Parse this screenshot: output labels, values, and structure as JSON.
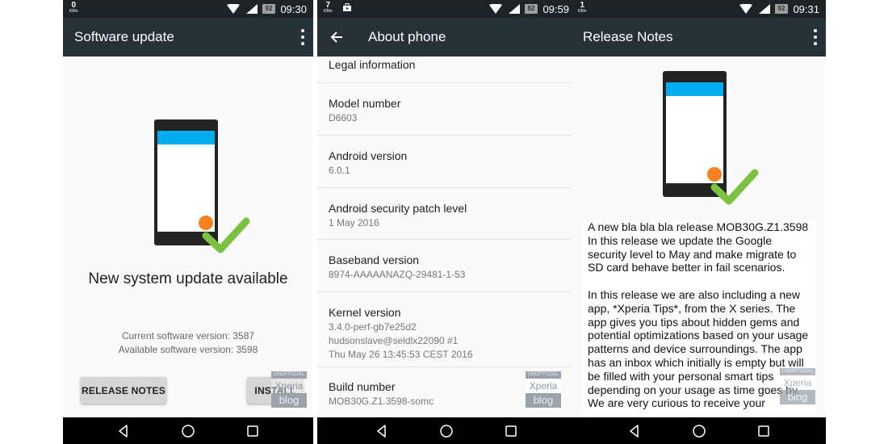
{
  "screens": [
    {
      "statusbar": {
        "speed": "0",
        "speed_unit": "KB/s",
        "battery": "92",
        "time": "09:30"
      },
      "appbar": {
        "title": "Software update",
        "menu_icon": "overflow-menu-icon"
      },
      "headline": "New system update available",
      "current_version_label": "Current software version:",
      "current_version": "3587",
      "available_version_label": "Available software version:",
      "available_version": "3598",
      "buttons": {
        "release_notes": "RELEASE NOTES",
        "install": "INSTALL"
      },
      "watermark": {
        "top": "UNOFFICIAL",
        "mid": "Xperia",
        "bot": "blog"
      }
    },
    {
      "statusbar": {
        "speed": "7",
        "speed_unit": "KB/s",
        "battery": "82",
        "time": "09:59",
        "extra_icon": "briefcase-icon"
      },
      "appbar": {
        "title": "About phone",
        "back_icon": "back-arrow-icon"
      },
      "items": [
        {
          "label": "Legal information",
          "lines": []
        },
        {
          "label": "Model number",
          "lines": [
            "D6603"
          ]
        },
        {
          "label": "Android version",
          "lines": [
            "6.0.1"
          ]
        },
        {
          "label": "Android security patch level",
          "lines": [
            "1 May 2016"
          ]
        },
        {
          "label": "Baseband version",
          "lines": [
            "8974-AAAAANAZQ-29481-1-53"
          ]
        },
        {
          "label": "Kernel version",
          "lines": [
            "3.4.0-perf-gb7e25d2",
            "hudsonslave@seldlx22090 #1",
            "Thu May 26 13:45:53 CEST 2016"
          ]
        },
        {
          "label": "Build number",
          "lines": [
            "MOB30G.Z1.3598-somc"
          ]
        }
      ],
      "watermark": {
        "top": "UNOFFICIAL",
        "mid": "Xperia",
        "bot": "blog"
      }
    },
    {
      "statusbar": {
        "speed": "1",
        "speed_unit": "KB/s",
        "battery": "92",
        "time": "09:31"
      },
      "appbar": {
        "title": "Release Notes",
        "menu_icon": "overflow-menu-icon"
      },
      "paragraphs": [
        "A new bla bla bla release MOB30G.Z1.3598 In this release we update the Google security level to May and make migrate to SD card behave better in fail scenarios.",
        "In this release we are also including a new app, *Xperia Tips*, from the X series. The app gives you tips about hidden gems and potential optimizations based on your usage patterns and device surroundings. The app has an inbox which initially is empty but will be filled with your personal smart tips depending on your usage as time goes by. We are very curious to receive your"
      ],
      "watermark": {
        "top": "UNOFFICIAL",
        "mid": "Xperia",
        "bot": "blog"
      }
    }
  ],
  "navbar": {
    "back": "nav-back-icon",
    "home": "nav-home-icon",
    "recents": "nav-recents-icon"
  },
  "colors": {
    "appbar": "#263238",
    "statusbar": "#1e2327",
    "phone_accent": "#00aeef",
    "dot": "#f5821f",
    "check": "#7cc242"
  }
}
